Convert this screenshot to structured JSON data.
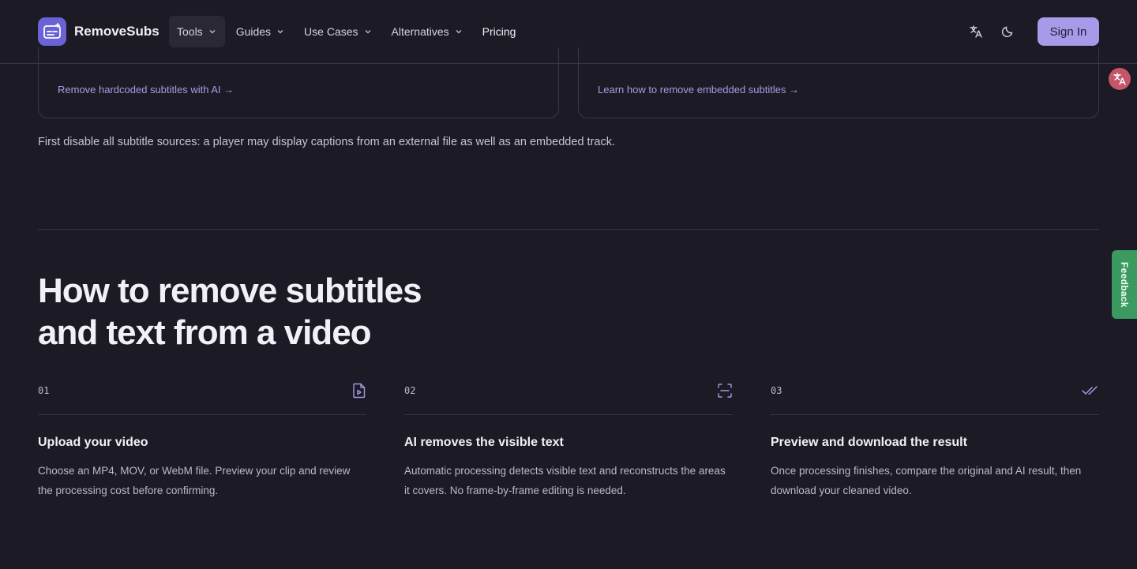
{
  "nav": {
    "brand": "RemoveSubs",
    "menu": [
      {
        "label": "Tools"
      },
      {
        "label": "Guides"
      },
      {
        "label": "Use Cases"
      },
      {
        "label": "Alternatives"
      },
      {
        "label": "Pricing"
      }
    ],
    "sign_in": "Sign In"
  },
  "cards": [
    {
      "link": "Remove hardcoded subtitles with AI →"
    },
    {
      "link": "Learn how to remove embedded subtitles →"
    }
  ],
  "note": "First disable all subtitle sources: a player may display captions from an external file as well as an embedded track.",
  "how_to": {
    "heading": "How to remove subtitles and text from a video",
    "steps": [
      {
        "num": "01",
        "icon": "video-file-icon",
        "title": "Upload your video",
        "desc": "Choose an MP4, MOV, or WebM file. Preview your clip and review the processing cost before confirming."
      },
      {
        "num": "02",
        "icon": "scan-icon",
        "title": "AI removes the visible text",
        "desc": "Automatic processing detects visible text and reconstructs the areas it covers. No frame-by-frame editing is needed."
      },
      {
        "num": "03",
        "icon": "double-check-icon",
        "title": "Preview and download the result",
        "desc": "Once processing finishes, compare the original and AI result, then download your cleaned video."
      }
    ]
  },
  "feedback": "Feedback",
  "colors": {
    "accent": "#a79ae8",
    "background": "#1c1a24",
    "feedback": "#3c9a61"
  }
}
